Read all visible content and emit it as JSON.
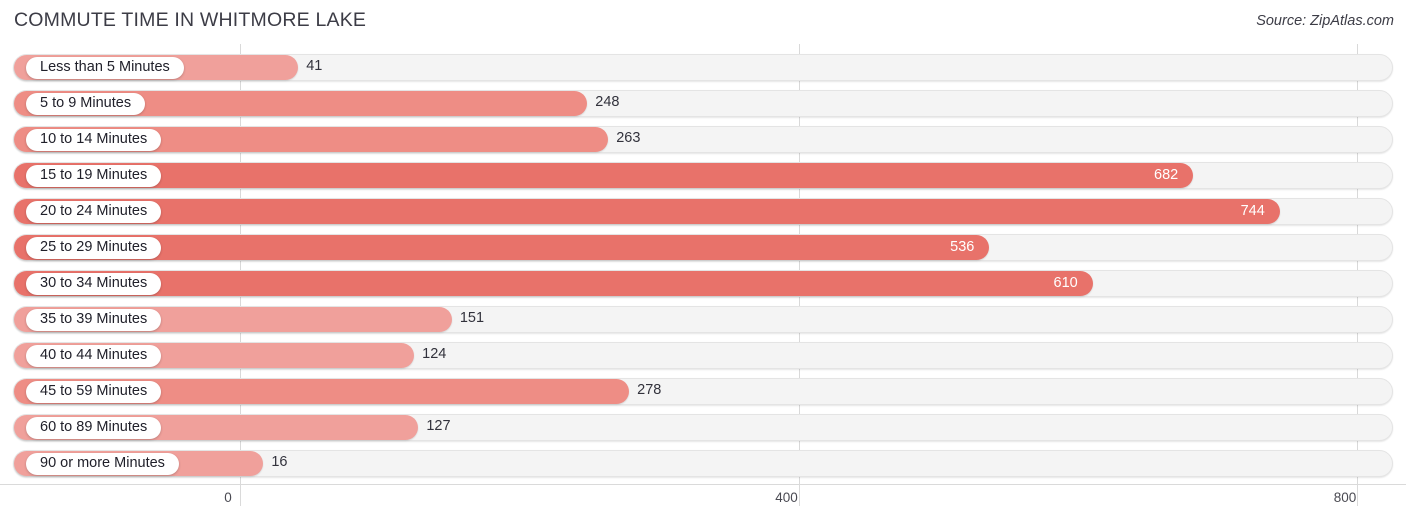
{
  "header": {
    "title": "COMMUTE TIME IN WHITMORE LAKE",
    "source": "Source: ZipAtlas.com"
  },
  "colors": {
    "bar_light": "#f0a09b",
    "bar_mid": "#ee8d85",
    "bar_strong": "#e8726a",
    "track": "#f4f4f4",
    "gridline": "#d9d9d9",
    "text": "#32323c",
    "value_inside": "#ffffff"
  },
  "chart_data": {
    "type": "bar",
    "orientation": "horizontal",
    "title": "COMMUTE TIME IN WHITMORE LAKE",
    "xlabel": "",
    "ylabel": "",
    "xlim": [
      0,
      800
    ],
    "ticks": [
      0,
      400,
      800
    ],
    "tick_labels": [
      "0",
      "400",
      "800"
    ],
    "grid": true,
    "legend": null,
    "categories": [
      "Less than 5 Minutes",
      "5 to 9 Minutes",
      "10 to 14 Minutes",
      "15 to 19 Minutes",
      "20 to 24 Minutes",
      "25 to 29 Minutes",
      "30 to 34 Minutes",
      "35 to 39 Minutes",
      "40 to 44 Minutes",
      "45 to 59 Minutes",
      "60 to 89 Minutes",
      "90 or more Minutes"
    ],
    "values": [
      41,
      248,
      263,
      682,
      744,
      536,
      610,
      151,
      124,
      278,
      127,
      16
    ],
    "value_labels": [
      "41",
      "248",
      "263",
      "682",
      "744",
      "536",
      "610",
      "151",
      "124",
      "278",
      "127",
      "16"
    ],
    "label_position": [
      "outside",
      "outside",
      "outside",
      "inside",
      "inside",
      "inside",
      "inside",
      "outside",
      "outside",
      "outside",
      "outside",
      "outside"
    ]
  }
}
